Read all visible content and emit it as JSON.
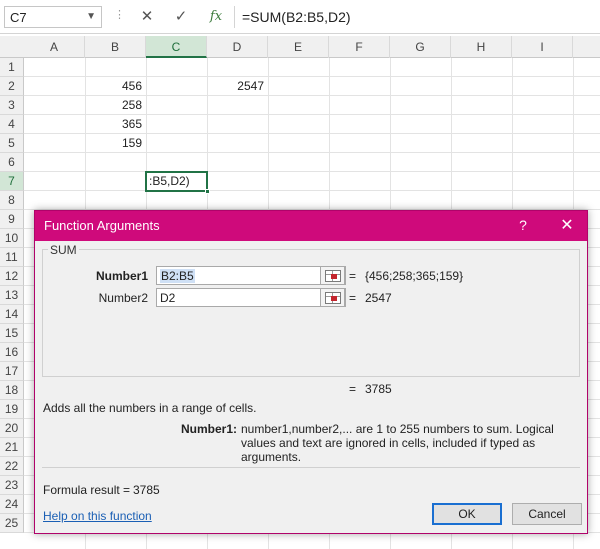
{
  "formula_bar": {
    "name_box": "C7",
    "cancel_glyph": "✕",
    "enter_glyph": "✓",
    "fx_label": "fx",
    "formula": "=SUM(B2:B5,D2)"
  },
  "sheet": {
    "columns": [
      "A",
      "B",
      "C",
      "D",
      "E",
      "F",
      "G",
      "H",
      "I"
    ],
    "selected_column": "C",
    "rows": [
      "1",
      "2",
      "3",
      "4",
      "5",
      "6",
      "7",
      "8",
      "9",
      "10",
      "11",
      "12",
      "13",
      "14",
      "15",
      "16",
      "17",
      "18",
      "19",
      "20",
      "21",
      "22",
      "23",
      "24",
      "25"
    ],
    "selected_row": "7",
    "cells": {
      "B2": "456",
      "B3": "258",
      "B4": "365",
      "B5": "159",
      "D2": "2547"
    },
    "active_cell_text": ":B5,D2)"
  },
  "dialog": {
    "title": "Function Arguments",
    "help_glyph": "?",
    "close_glyph": "✕",
    "function_name": "SUM",
    "args": [
      {
        "label": "Number1",
        "value": "B2:B5",
        "result": "{456;258;365;159}"
      },
      {
        "label": "Number2",
        "value": "D2",
        "result": "2547"
      }
    ],
    "equals": "=",
    "total_result": "3785",
    "description": "Adds all the numbers in a range of cells.",
    "arg_desc_label": "Number1:",
    "arg_desc_text": "number1,number2,... are 1 to 255 numbers to sum. Logical values and text are ignored in cells, included if typed as arguments.",
    "formula_result_label": "Formula result =",
    "formula_result_value": "3785",
    "help_link": "Help on this function",
    "ok_label": "OK",
    "cancel_label": "Cancel"
  },
  "colors": {
    "dialog_title_bg": "#cf0a7b",
    "excel_green": "#217346",
    "link": "#1a5fb4"
  }
}
